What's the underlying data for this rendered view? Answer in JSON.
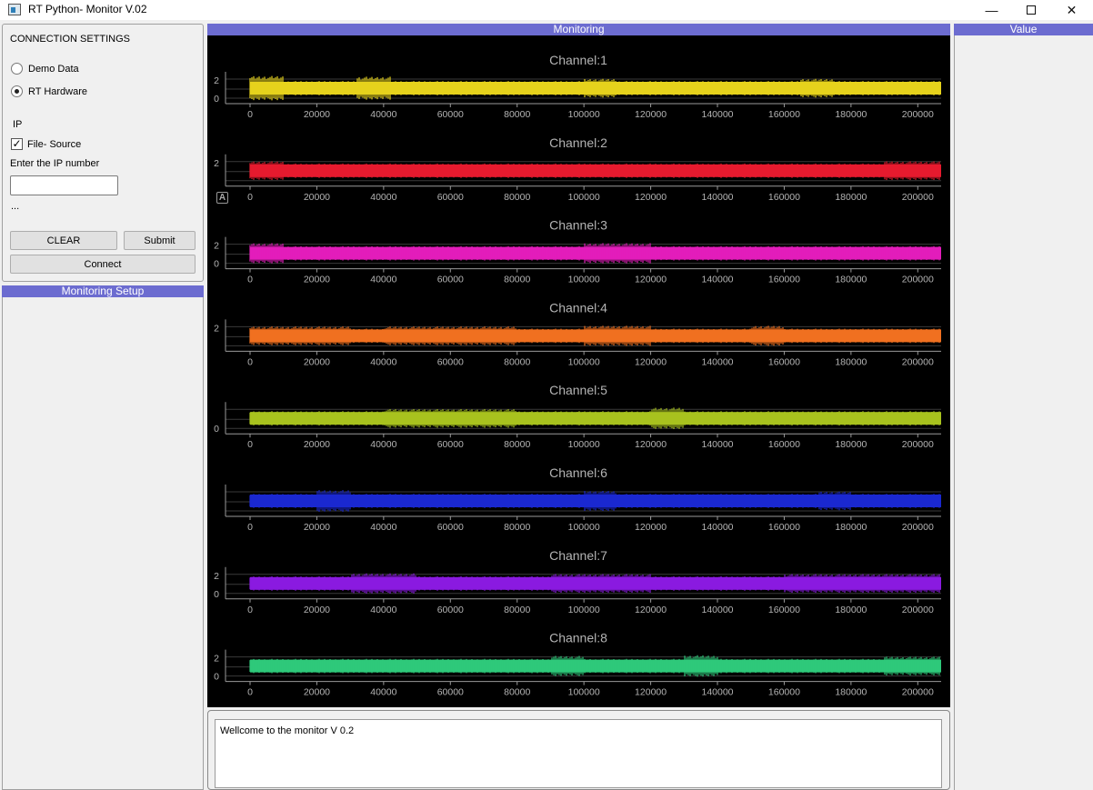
{
  "window": {
    "title": "RT Python- Monitor V.02",
    "minimize": "—",
    "close": "✕"
  },
  "connection": {
    "title": "CONNECTION SETTINGS",
    "radio_demo": "Demo Data",
    "radio_hardware": "RT Hardware",
    "ip_label": "IP",
    "file_source": "File- Source",
    "ip_prompt": "Enter the IP number",
    "ip_value": "",
    "ellipsis": "...",
    "clear_button": "CLEAR",
    "submit_button": "Submit",
    "connect_button": "Connect"
  },
  "headers": {
    "setup": "Monitoring Setup",
    "monitoring": "Monitoring",
    "value": "Value"
  },
  "badge": "A",
  "x_ticks": [
    "0",
    "20000",
    "40000",
    "60000",
    "80000",
    "100000",
    "120000",
    "140000",
    "160000",
    "180000",
    "200000"
  ],
  "channels": [
    {
      "title": "Channel:1",
      "color": "#e6d21c",
      "y_ticks": [
        "2",
        "0"
      ]
    },
    {
      "title": "Channel:2",
      "color": "#e61a2e",
      "y_ticks": [
        "2"
      ]
    },
    {
      "title": "Channel:3",
      "color": "#e31dbb",
      "y_ticks": [
        "2",
        "0"
      ]
    },
    {
      "title": "Channel:4",
      "color": "#f07020",
      "y_ticks": [
        "2"
      ]
    },
    {
      "title": "Channel:5",
      "color": "#a8c21e",
      "y_ticks": [
        "0"
      ]
    },
    {
      "title": "Channel:6",
      "color": "#1a28d0",
      "y_ticks": []
    },
    {
      "title": "Channel:7",
      "color": "#8a1ae0",
      "y_ticks": [
        "2",
        "0"
      ]
    },
    {
      "title": "Channel:8",
      "color": "#2ec97a",
      "y_ticks": [
        "2",
        "0"
      ]
    }
  ],
  "console": {
    "text": "Wellcome to the monitor V 0.2"
  }
}
